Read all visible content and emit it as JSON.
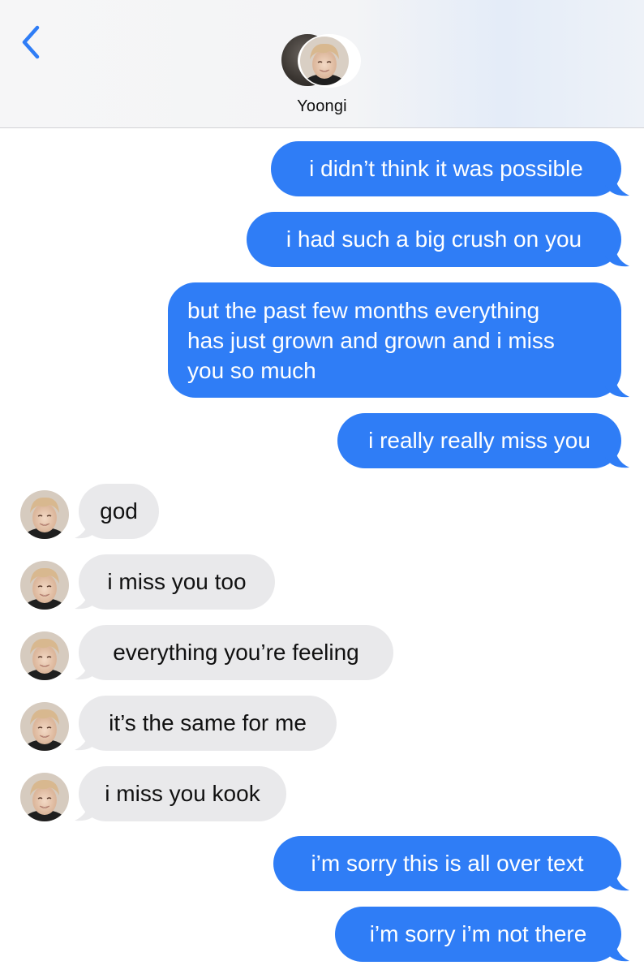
{
  "header": {
    "contact_name": "Yoongi",
    "back_icon": "chevron-left-icon",
    "accent_color": "#2f7df6"
  },
  "colors": {
    "sent_bubble": "#2f7df6",
    "received_bubble": "#e9e9eb",
    "sent_text": "#ffffff",
    "received_text": "#111111"
  },
  "messages": [
    {
      "direction": "sent",
      "text": "i didn’t think it was possible"
    },
    {
      "direction": "sent",
      "text": "i had such a big crush on you"
    },
    {
      "direction": "sent",
      "lines": [
        "but the past few months everything",
        "has just grown and grown and i miss",
        "you so much"
      ]
    },
    {
      "direction": "sent",
      "text": "i really really miss you"
    },
    {
      "direction": "received",
      "text": "god"
    },
    {
      "direction": "received",
      "text": "i miss you too"
    },
    {
      "direction": "received",
      "text": "everything you’re feeling"
    },
    {
      "direction": "received",
      "text": "it’s the same for me"
    },
    {
      "direction": "received",
      "text": "i miss you kook"
    },
    {
      "direction": "sent",
      "text": "i’m sorry this is all over text"
    },
    {
      "direction": "sent",
      "text": "i’m sorry i’m not there"
    }
  ]
}
